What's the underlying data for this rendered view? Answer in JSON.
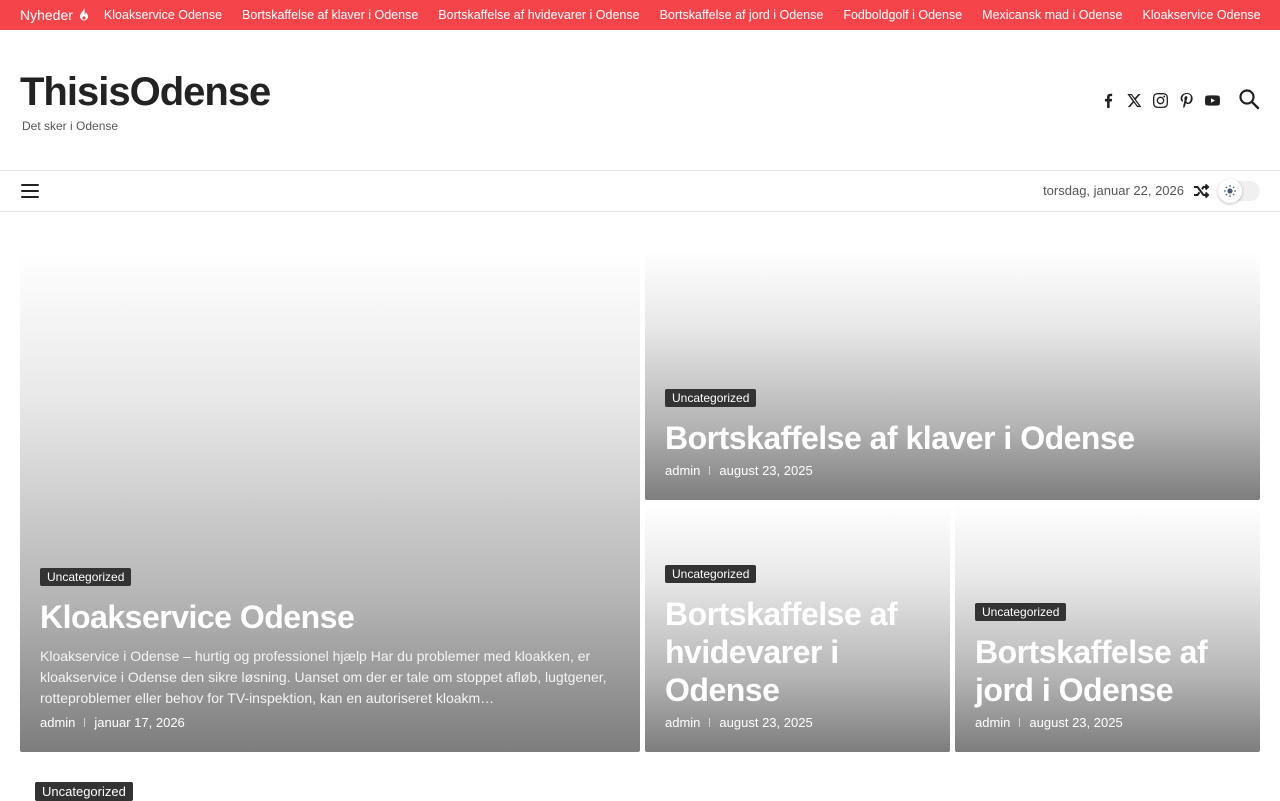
{
  "ticker": {
    "label": "Nyheder",
    "items": [
      "Kloakservice Odense",
      "Bortskaffelse af klaver i Odense",
      "Bortskaffelse af hvidevarer i Odense",
      "Bortskaffelse af jord i Odense",
      "Fodboldgolf i Odense",
      "Mexicansk mad i Odense",
      "Kloakservice Odense"
    ],
    "color": "#f5454b"
  },
  "header": {
    "title": "ThisisOdense",
    "tagline": "Det sker i Odense",
    "social": [
      "facebook-icon",
      "x-icon",
      "instagram-icon",
      "pinterest-icon",
      "youtube-icon"
    ]
  },
  "navbar": {
    "date": "torsdag, januar 22, 2026"
  },
  "cards": [
    {
      "category": "Uncategorized",
      "title": "Kloakservice Odense",
      "excerpt": "Kloakservice i Odense – hurtig og professionel hjælp Har du problemer med kloakken, er kloakservice i Odense den sikre løsning. Uanset om der er tale om stoppet afløb, lugtgener, rotteproblemer eller behov for TV-inspektion, kan en autoriseret kloakm…",
      "author": "admin",
      "date": "januar 17, 2026"
    },
    {
      "category": "Uncategorized",
      "title": "Bortskaffelse af klaver i Odense",
      "author": "admin",
      "date": "august 23, 2025"
    },
    {
      "category": "Uncategorized",
      "title": "Bortskaffelse af hvidevarer i Odense",
      "author": "admin",
      "date": "august 23, 2025"
    },
    {
      "category": "Uncategorized",
      "title": "Bortskaffelse af jord i Odense",
      "author": "admin",
      "date": "august 23, 2025"
    }
  ],
  "bottom": {
    "category": "Uncategorized"
  }
}
